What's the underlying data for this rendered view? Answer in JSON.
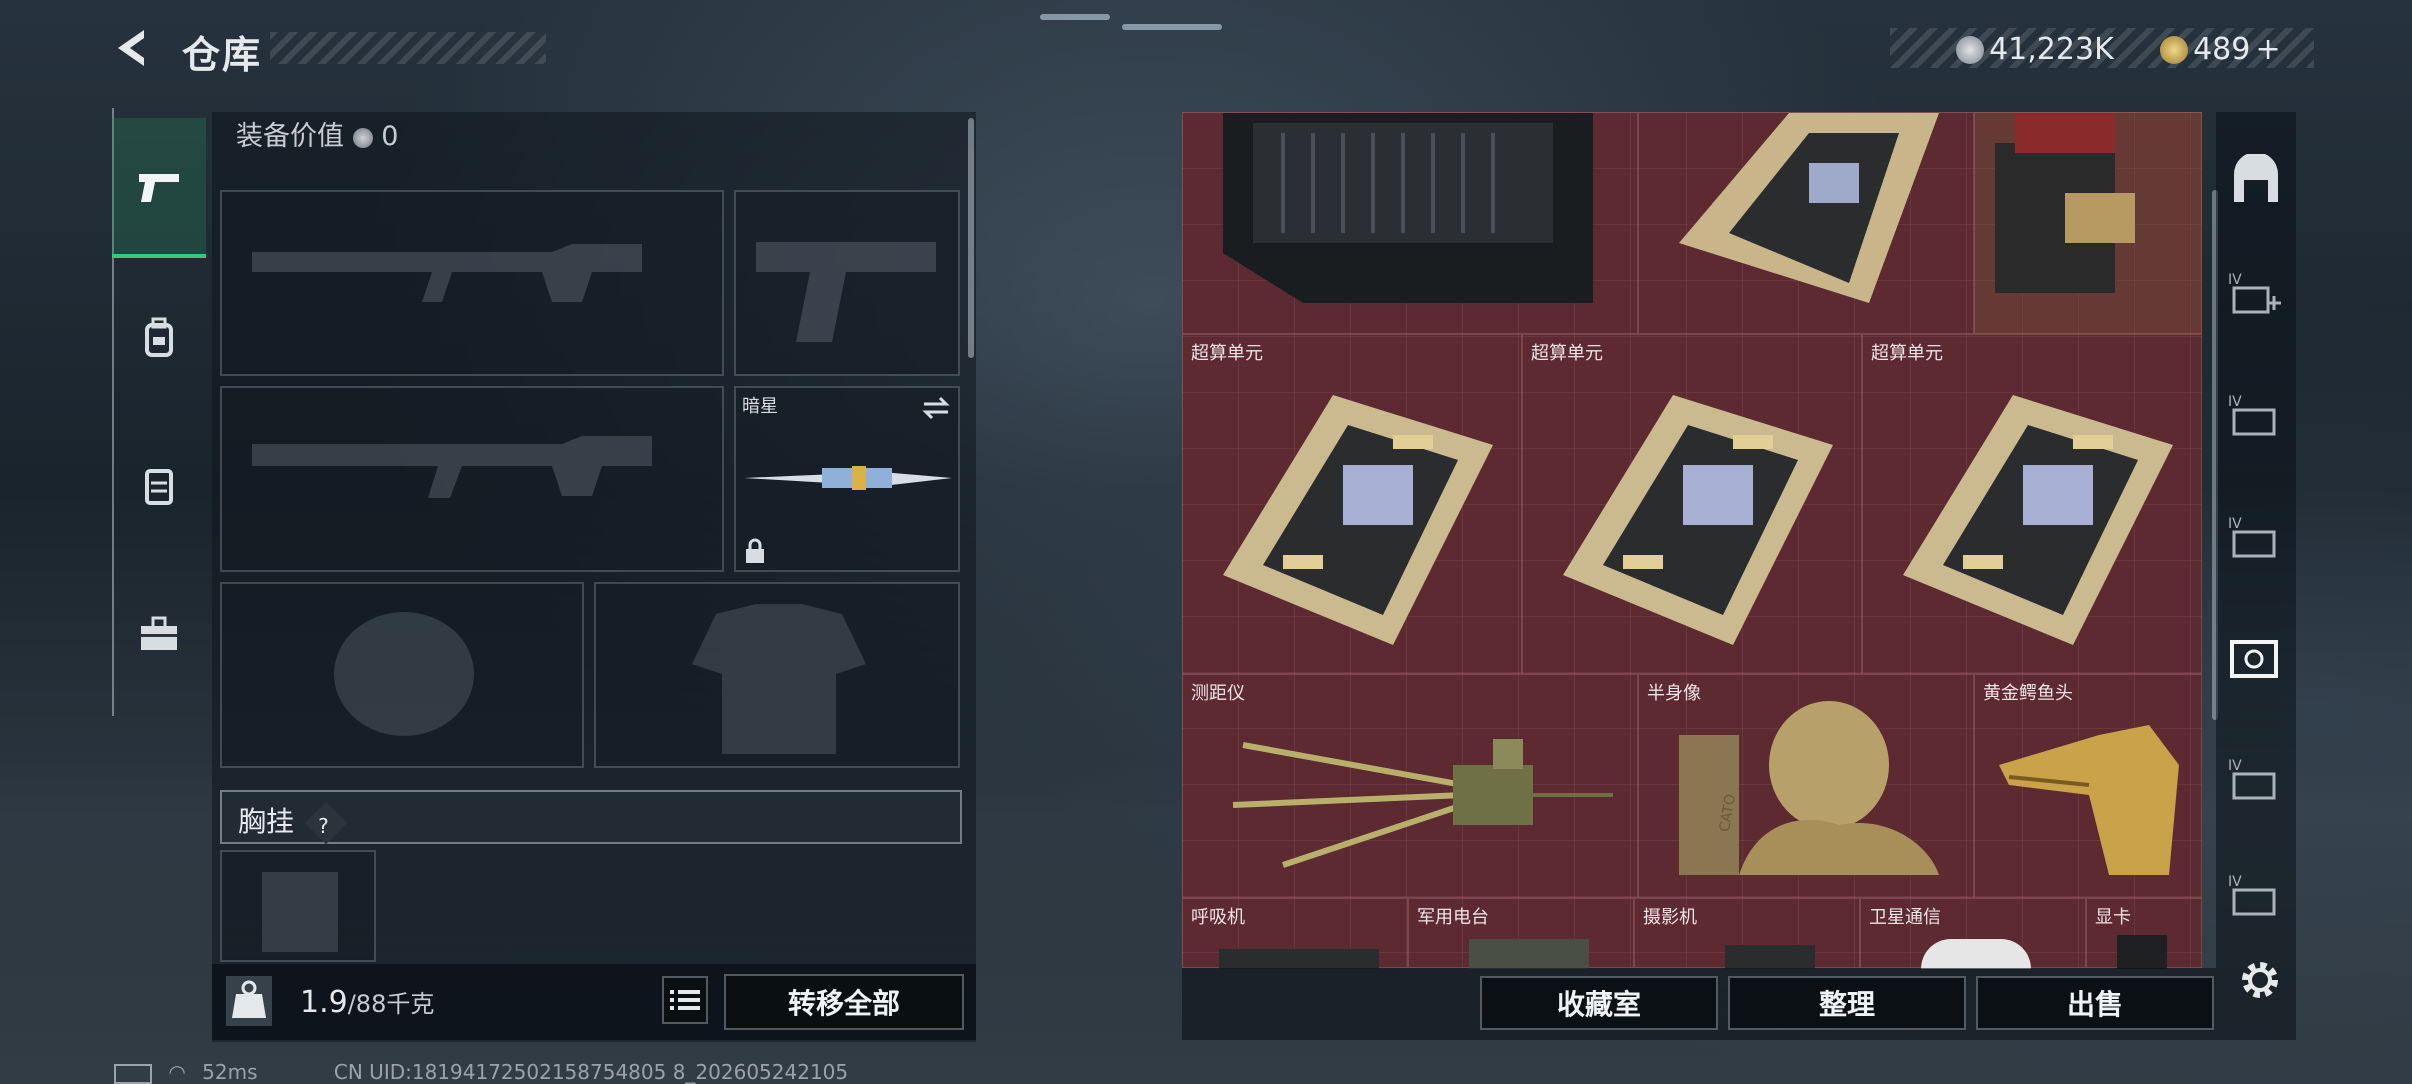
{
  "header": {
    "title": "仓库",
    "coins": "41,223K",
    "gold": "489",
    "add_symbol": "+"
  },
  "equipment": {
    "value_label": "装备价值",
    "value": "0",
    "melee_name": "暗星",
    "chest_label": "胸挂",
    "help_symbol": "?"
  },
  "bottom_left": {
    "weight_current": "1.9",
    "weight_max": "/88千克",
    "transfer_all": "转移全部"
  },
  "storage": {
    "items": [
      {
        "label": ""
      },
      {
        "label": ""
      },
      {
        "label": ""
      },
      {
        "label": "超算单元"
      },
      {
        "label": "超算单元"
      },
      {
        "label": "超算单元"
      },
      {
        "label": "测距仪"
      },
      {
        "label": "半身像"
      },
      {
        "label": "黄金鳄鱼头"
      },
      {
        "label": "呼吸机"
      },
      {
        "label": "军用电台"
      },
      {
        "label": "摄影机"
      },
      {
        "label": "卫星通信"
      },
      {
        "label": "显卡"
      }
    ],
    "bust_engraving": "CATO"
  },
  "actions": {
    "collection": "收藏室",
    "sort": "整理",
    "sell": "出售"
  },
  "status": {
    "ping": "52ms",
    "uid": "CN UID:18194172502158754805 8_202605242105"
  },
  "colors": {
    "accent_green": "#37c77e",
    "grid_bg": "#5c2a30",
    "gold": "#c9a24a"
  },
  "icons": [
    "back-arrow-icon",
    "silver-coin-icon",
    "gold-coin-icon",
    "pistol-icon",
    "backpack-icon",
    "armor-icon",
    "toolbox-icon",
    "weight-icon",
    "list-icon",
    "settings-icon"
  ]
}
